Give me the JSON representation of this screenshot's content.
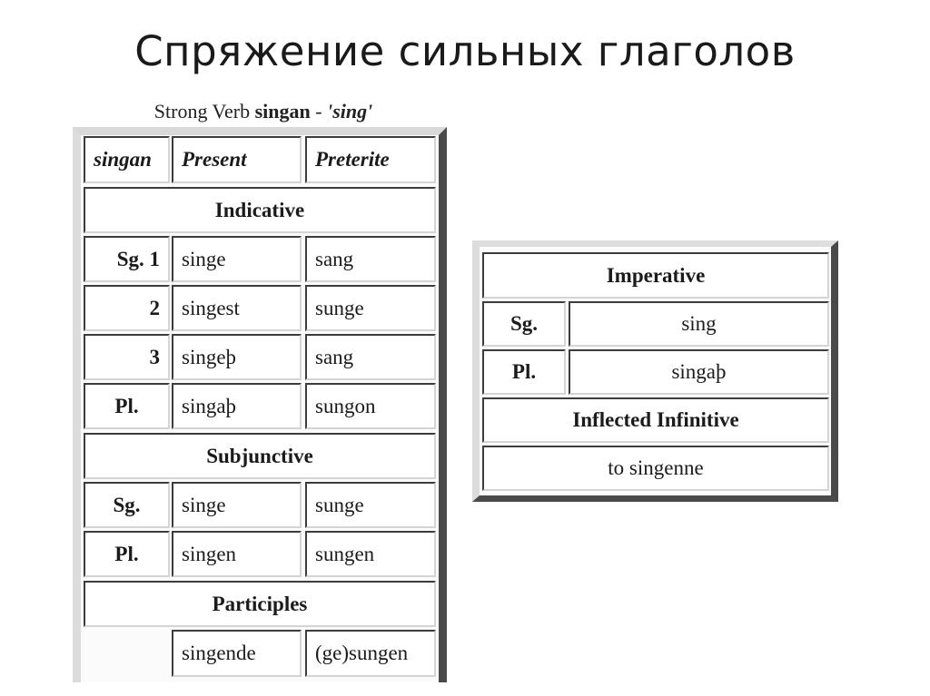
{
  "slide": {
    "title": "Спряжение сильных глаголов"
  },
  "caption": {
    "prefix": "Strong Verb ",
    "verb": "singan",
    "separator": " - ",
    "gloss": "'sing'"
  },
  "conjugation_table": {
    "headers": [
      "singan",
      "Present",
      "Preterite"
    ],
    "indicative": {
      "label": "Indicative",
      "rows": [
        {
          "label": "Sg. 1",
          "present": "singe",
          "preterite": "sang"
        },
        {
          "label": "2",
          "present": "singest",
          "preterite": "sunge"
        },
        {
          "label": "3",
          "present": "singeþ",
          "preterite": "sang"
        },
        {
          "label": "Pl.",
          "present": "singaþ",
          "preterite": "sungon"
        }
      ]
    },
    "subjunctive": {
      "label": "Subjunctive",
      "rows": [
        {
          "label": "Sg.",
          "present": "singe",
          "preterite": "sunge"
        },
        {
          "label": "Pl.",
          "present": "singen",
          "preterite": "sungen"
        }
      ]
    },
    "participles": {
      "label": "Participles",
      "present": "singende",
      "preterite": "(ge)sungen"
    }
  },
  "imperative_table": {
    "imperative_label": "Imperative",
    "rows": [
      {
        "label": "Sg.",
        "value": "sing"
      },
      {
        "label": "Pl.",
        "value": "singaþ"
      }
    ],
    "inflected_infinitive_label": "Inflected Infinitive",
    "inflected_infinitive_value": "to singenne"
  }
}
